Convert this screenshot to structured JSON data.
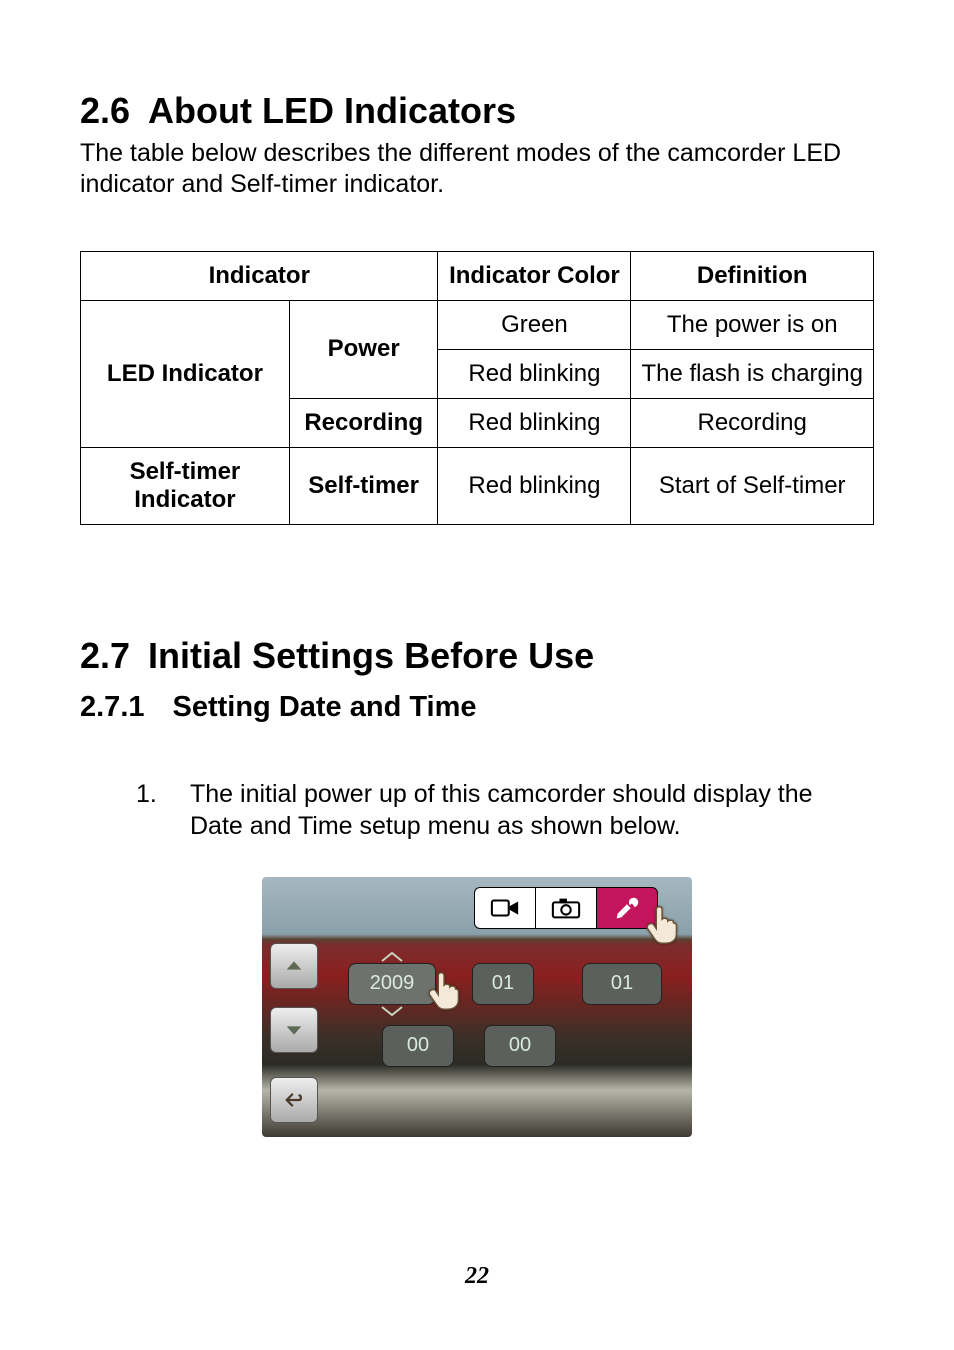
{
  "section26": {
    "number": "2.6",
    "title": "About LED Indicators",
    "intro": "The table below describes the different modes of the camcorder LED indicator and Self-timer indicator."
  },
  "table": {
    "head": {
      "c0": "Indicator",
      "c1": "Indicator Color",
      "c2": "Definition"
    },
    "rows": {
      "led_label": "LED Indicator",
      "power_label": "Power",
      "r0": {
        "color": "Green",
        "def": "The power is on"
      },
      "r1": {
        "color": "Red blinking",
        "def": "The flash is charging"
      },
      "recording_label": "Recording",
      "r2": {
        "color": "Red blinking",
        "def": "Recording"
      },
      "self_label": "Self-timer Indicator",
      "self_mode": "Self-timer",
      "r3": {
        "color": "Red blinking",
        "def": "Start of Self-timer"
      }
    }
  },
  "section27": {
    "number": "2.7",
    "title": "Initial Settings Before Use",
    "sub_number": "2.7.1",
    "sub_title": "Setting Date and Time",
    "step1_num": "1.",
    "step1_text": "The initial power up of this camcorder should display the Date and Time setup menu as shown below."
  },
  "figure": {
    "icons": {
      "tab0": "video-icon",
      "tab1": "camera-icon",
      "tab2": "wrench-icon"
    },
    "fields": {
      "year": "2009",
      "month": "01",
      "day": "01",
      "hour": "00",
      "minute": "00"
    }
  },
  "page_number": "22"
}
